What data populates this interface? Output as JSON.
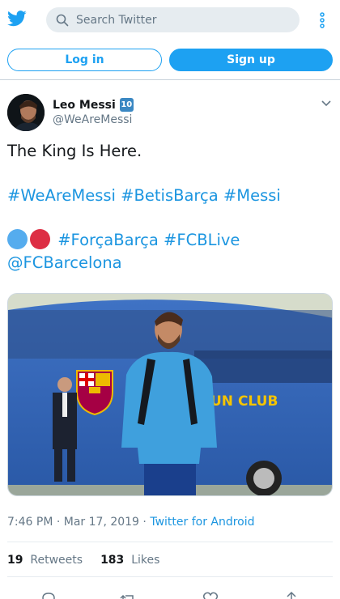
{
  "header": {
    "search_placeholder": "Search Twitter",
    "icons": [
      "twitter-bird-icon",
      "search-icon",
      "more-vertical-icon"
    ]
  },
  "auth": {
    "login_label": "Log in",
    "signup_label": "Sign up"
  },
  "tweet": {
    "author_name": "Leo Messi",
    "author_emoji": "10",
    "author_handle": "@WeAreMessi",
    "text_line1": "The King Is Here.",
    "hashtags_line": [
      "#WeAreMessi",
      "#BetisBarça",
      "#Messi"
    ],
    "emoji_dots": [
      "#55acee",
      "#dd2e44"
    ],
    "hashtags_line2": [
      "#ForçaBarça",
      "#FCBLive"
    ],
    "mention": "@FCBarcelona",
    "timestamp": "7:46 PM · Mar 17, 2019 · ",
    "source": "Twitter for Android",
    "retweets_count": "19",
    "retweets_label": "Retweets",
    "likes_count": "183",
    "likes_label": "Likes",
    "image_text": "UN CLUB"
  },
  "colors": {
    "brand_blue": "#1da1f2",
    "link_blue": "#1b95e0",
    "muted": "#657786",
    "search_bg": "#e6ecf0"
  },
  "actions": [
    "reply-icon",
    "retweet-icon",
    "like-icon",
    "share-icon"
  ]
}
